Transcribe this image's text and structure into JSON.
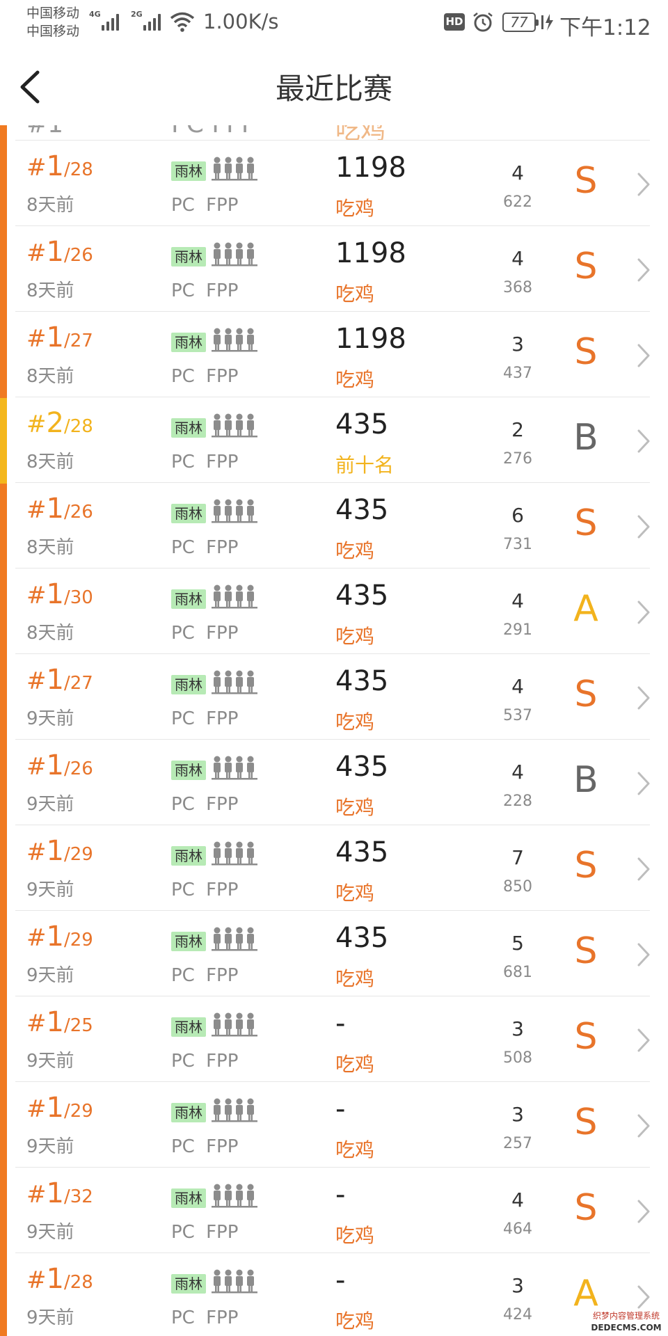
{
  "status_bar": {
    "carrier1": "中国移动",
    "carrier2": "中国移动",
    "net1": "4G",
    "net2": "2G",
    "speed": "1.00K/s",
    "hd": "HD",
    "battery": "77",
    "time": "下午1:12"
  },
  "header": {
    "title": "最近比赛"
  },
  "colors": {
    "accent_orange": "#e8742a",
    "accent_yellow": "#f2b31d",
    "map_tag_bg": "#b7eab5",
    "grade_S": "#e8742a",
    "grade_A": "#f2b31d",
    "grade_B": "#666666"
  },
  "matches": [
    {
      "rank": "1",
      "total": "/28",
      "time": "8天前",
      "map": "雨林",
      "mode": "PC FPP",
      "score": "1198",
      "result": "吃鸡",
      "kills": "4",
      "damage": "622",
      "grade": "S"
    },
    {
      "rank": "1",
      "total": "/26",
      "time": "8天前",
      "map": "雨林",
      "mode": "PC FPP",
      "score": "1198",
      "result": "吃鸡",
      "kills": "4",
      "damage": "368",
      "grade": "S"
    },
    {
      "rank": "1",
      "total": "/27",
      "time": "8天前",
      "map": "雨林",
      "mode": "PC FPP",
      "score": "1198",
      "result": "吃鸡",
      "kills": "3",
      "damage": "437",
      "grade": "S"
    },
    {
      "rank": "2",
      "total": "/28",
      "time": "8天前",
      "map": "雨林",
      "mode": "PC FPP",
      "score": "435",
      "result": "前十名",
      "kills": "2",
      "damage": "276",
      "grade": "B"
    },
    {
      "rank": "1",
      "total": "/26",
      "time": "8天前",
      "map": "雨林",
      "mode": "PC FPP",
      "score": "435",
      "result": "吃鸡",
      "kills": "6",
      "damage": "731",
      "grade": "S"
    },
    {
      "rank": "1",
      "total": "/30",
      "time": "8天前",
      "map": "雨林",
      "mode": "PC FPP",
      "score": "435",
      "result": "吃鸡",
      "kills": "4",
      "damage": "291",
      "grade": "A"
    },
    {
      "rank": "1",
      "total": "/27",
      "time": "9天前",
      "map": "雨林",
      "mode": "PC FPP",
      "score": "435",
      "result": "吃鸡",
      "kills": "4",
      "damage": "537",
      "grade": "S"
    },
    {
      "rank": "1",
      "total": "/26",
      "time": "9天前",
      "map": "雨林",
      "mode": "PC FPP",
      "score": "435",
      "result": "吃鸡",
      "kills": "4",
      "damage": "228",
      "grade": "B"
    },
    {
      "rank": "1",
      "total": "/29",
      "time": "9天前",
      "map": "雨林",
      "mode": "PC FPP",
      "score": "435",
      "result": "吃鸡",
      "kills": "7",
      "damage": "850",
      "grade": "S"
    },
    {
      "rank": "1",
      "total": "/29",
      "time": "9天前",
      "map": "雨林",
      "mode": "PC FPP",
      "score": "435",
      "result": "吃鸡",
      "kills": "5",
      "damage": "681",
      "grade": "S"
    },
    {
      "rank": "1",
      "total": "/25",
      "time": "9天前",
      "map": "雨林",
      "mode": "PC FPP",
      "score": "-",
      "result": "吃鸡",
      "kills": "3",
      "damage": "508",
      "grade": "S"
    },
    {
      "rank": "1",
      "total": "/29",
      "time": "9天前",
      "map": "雨林",
      "mode": "PC FPP",
      "score": "-",
      "result": "吃鸡",
      "kills": "3",
      "damage": "257",
      "grade": "S"
    },
    {
      "rank": "1",
      "total": "/32",
      "time": "9天前",
      "map": "雨林",
      "mode": "PC FPP",
      "score": "-",
      "result": "吃鸡",
      "kills": "4",
      "damage": "464",
      "grade": "S"
    },
    {
      "rank": "1",
      "total": "/28",
      "time": "9天前",
      "map": "雨林",
      "mode": "PC FPP",
      "score": "-",
      "result": "吃鸡",
      "kills": "3",
      "damage": "424",
      "grade": "A"
    }
  ],
  "watermark": {
    "line1": "织梦内容管理系统",
    "line2": "DEDECMS.COM"
  }
}
